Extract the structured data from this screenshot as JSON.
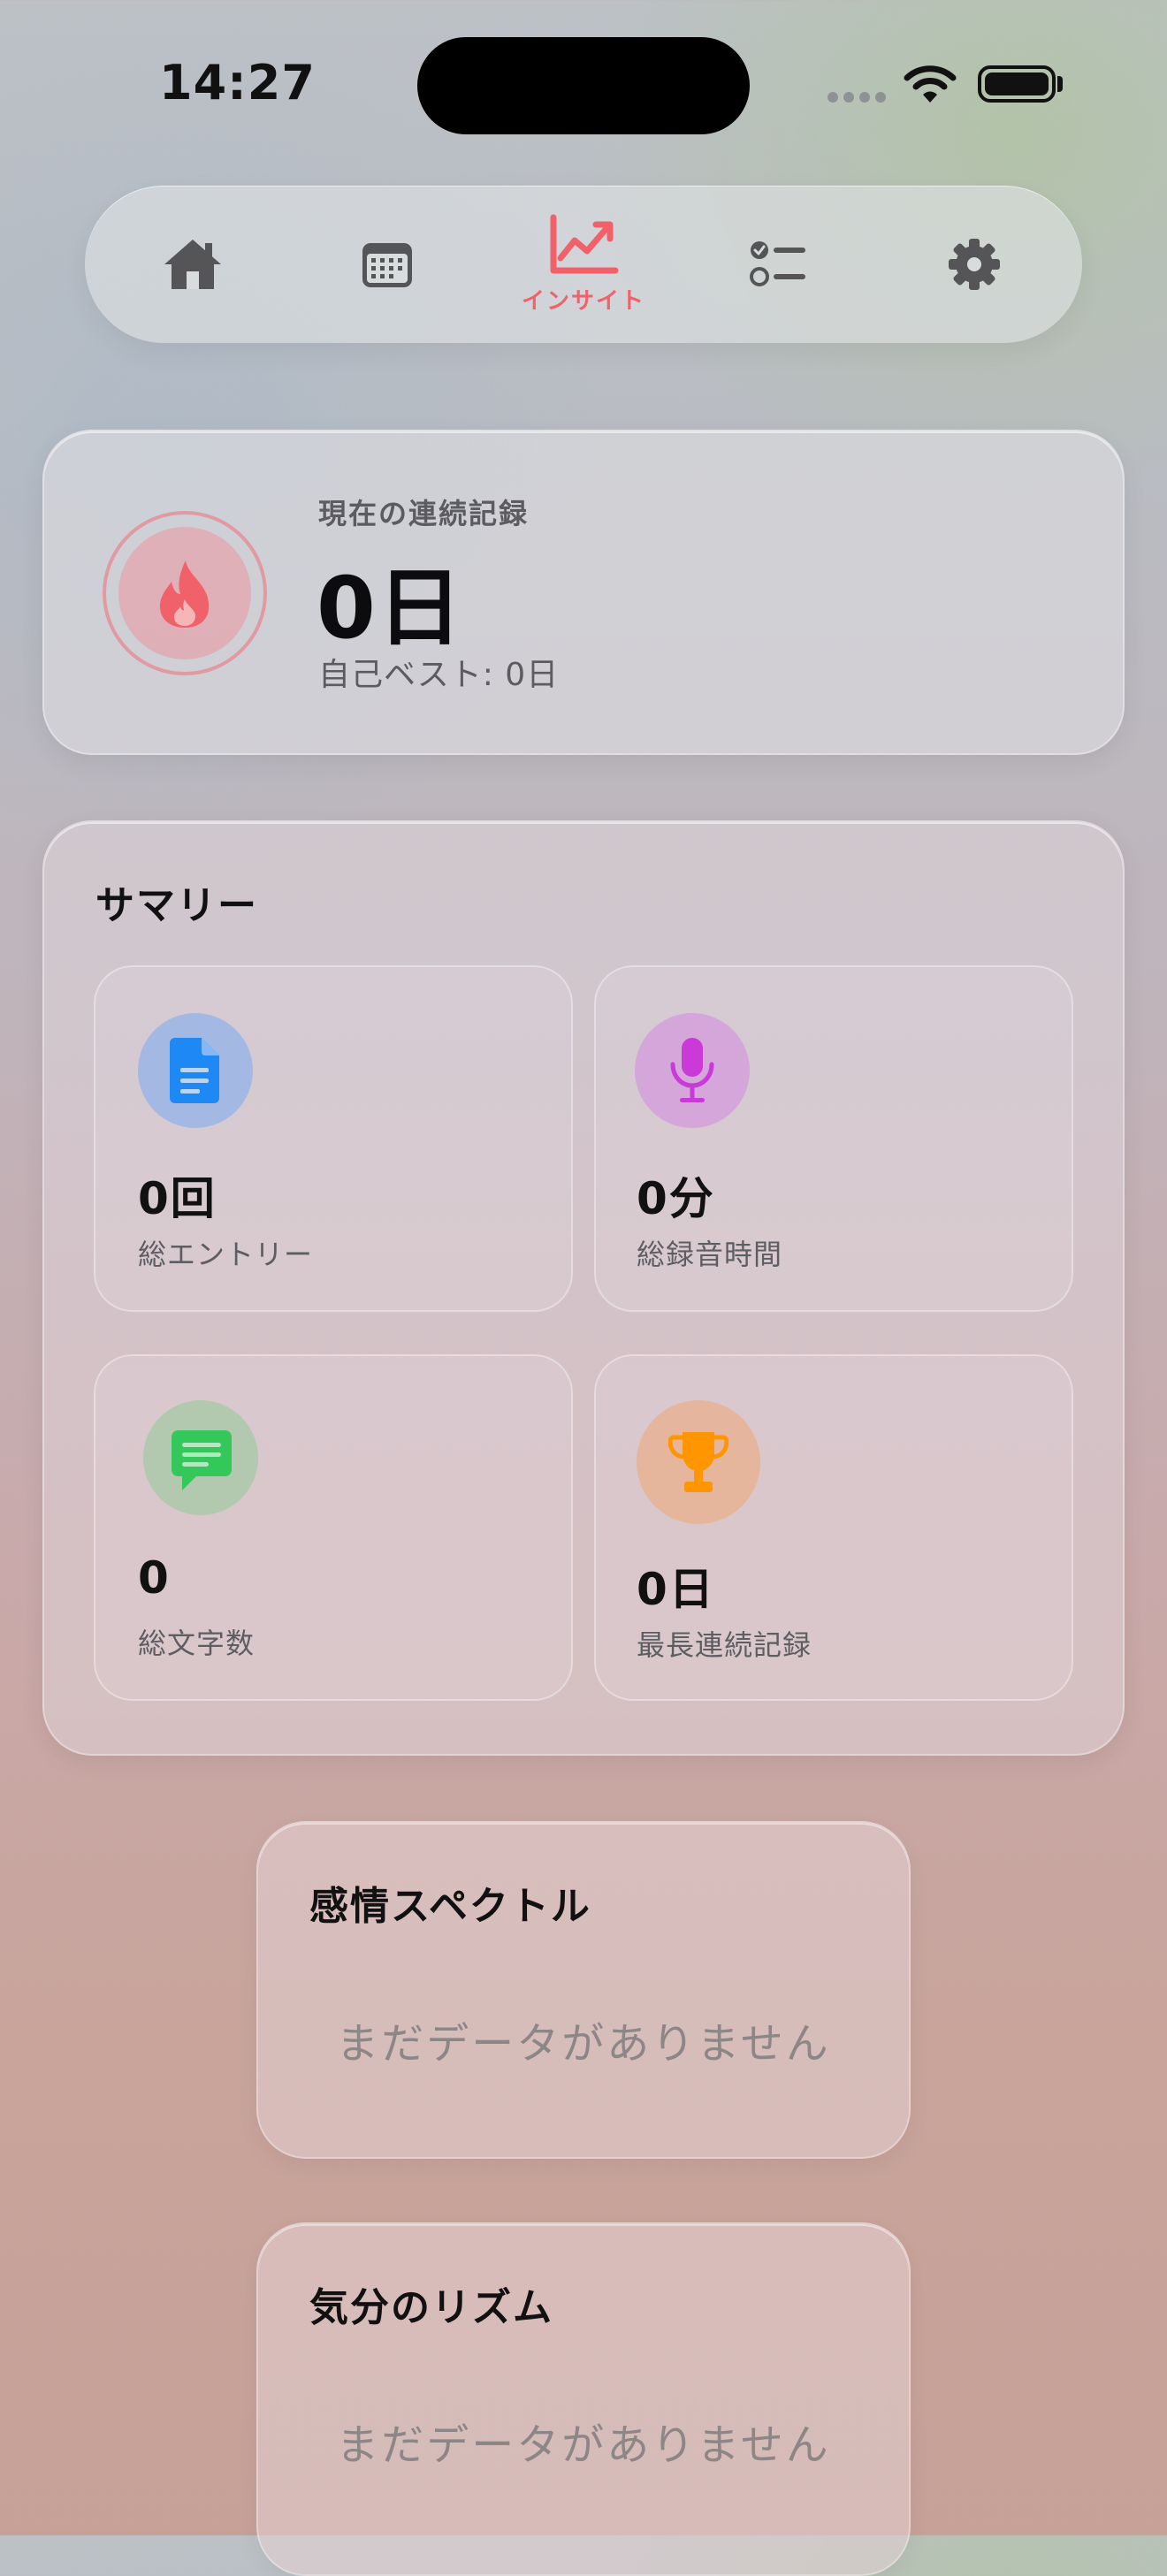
{
  "status_bar": {
    "time": "14:27"
  },
  "tabs": [
    {
      "icon": "house-icon",
      "label": ""
    },
    {
      "icon": "calendar-icon",
      "label": ""
    },
    {
      "icon": "chart-line-icon",
      "label": "インサイト",
      "active": true
    },
    {
      "icon": "checklist-icon",
      "label": ""
    },
    {
      "icon": "gear-icon",
      "label": ""
    }
  ],
  "accent_color": "#f0616a",
  "streak": {
    "label": "現在の連続記録",
    "value": "0日",
    "best": "自己ベスト: 0日"
  },
  "summary": {
    "title": "サマリー",
    "tiles": [
      {
        "icon": "document-icon",
        "value": "0回",
        "label": "総エントリー",
        "color": "#1e88f5"
      },
      {
        "icon": "microphone-icon",
        "value": "0分",
        "label": "総録音時間",
        "color": "#c93ad8"
      },
      {
        "icon": "message-icon",
        "value": "0",
        "label": "総文字数",
        "color": "#34c759"
      },
      {
        "icon": "trophy-icon",
        "value": "0日",
        "label": "最長連続記録",
        "color": "#ff9500"
      }
    ]
  },
  "emotion_spectrum": {
    "title": "感情スペクトル",
    "empty": "まだデータがありません"
  },
  "mood_rhythm": {
    "title": "気分のリズム",
    "empty": "まだデータがありません"
  }
}
